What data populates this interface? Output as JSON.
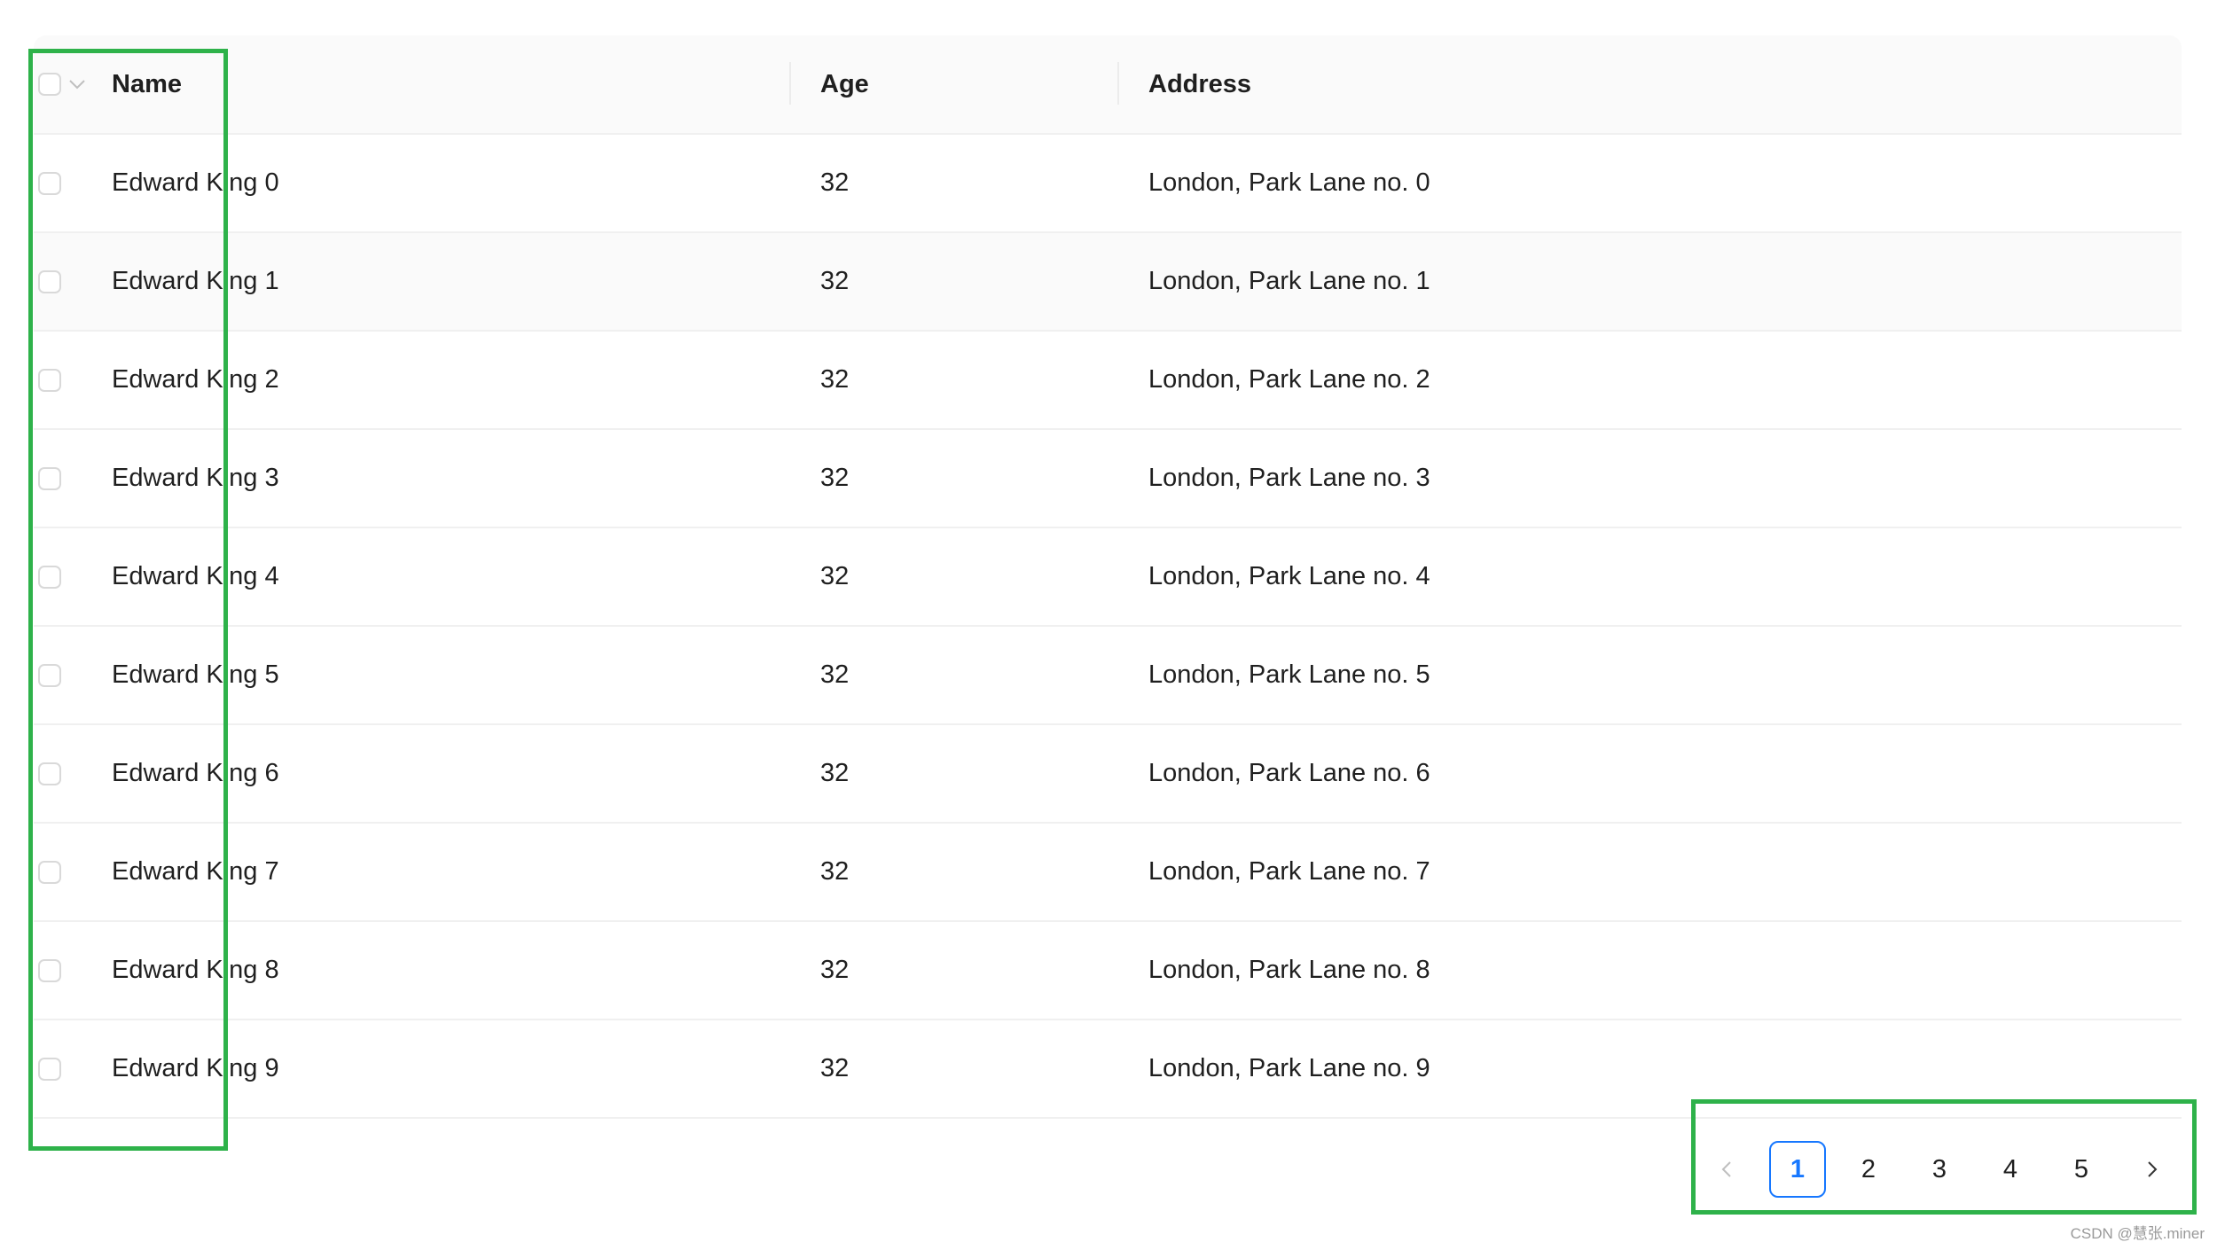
{
  "table": {
    "columns": {
      "name": "Name",
      "age": "Age",
      "address": "Address"
    },
    "rows": [
      {
        "name": "Edward King 0",
        "age": "32",
        "address": "London, Park Lane no. 0"
      },
      {
        "name": "Edward King 1",
        "age": "32",
        "address": "London, Park Lane no. 1"
      },
      {
        "name": "Edward King 2",
        "age": "32",
        "address": "London, Park Lane no. 2"
      },
      {
        "name": "Edward King 3",
        "age": "32",
        "address": "London, Park Lane no. 3"
      },
      {
        "name": "Edward King 4",
        "age": "32",
        "address": "London, Park Lane no. 4"
      },
      {
        "name": "Edward King 5",
        "age": "32",
        "address": "London, Park Lane no. 5"
      },
      {
        "name": "Edward King 6",
        "age": "32",
        "address": "London, Park Lane no. 6"
      },
      {
        "name": "Edward King 7",
        "age": "32",
        "address": "London, Park Lane no. 7"
      },
      {
        "name": "Edward King 8",
        "age": "32",
        "address": "London, Park Lane no. 8"
      },
      {
        "name": "Edward King 9",
        "age": "32",
        "address": "London, Park Lane no. 9"
      }
    ],
    "hover_row_index": 1,
    "select_all_icon": "chevron-down-icon",
    "row_checkbox_checked": false
  },
  "pagination": {
    "prev_icon": "chevron-left-icon",
    "next_icon": "chevron-right-icon",
    "pages": [
      "1",
      "2",
      "3",
      "4",
      "5"
    ],
    "current": "1",
    "active_color": "#1677ff"
  },
  "annotation_color": "#2eb24a",
  "watermark": "CSDN @慧张.miner"
}
